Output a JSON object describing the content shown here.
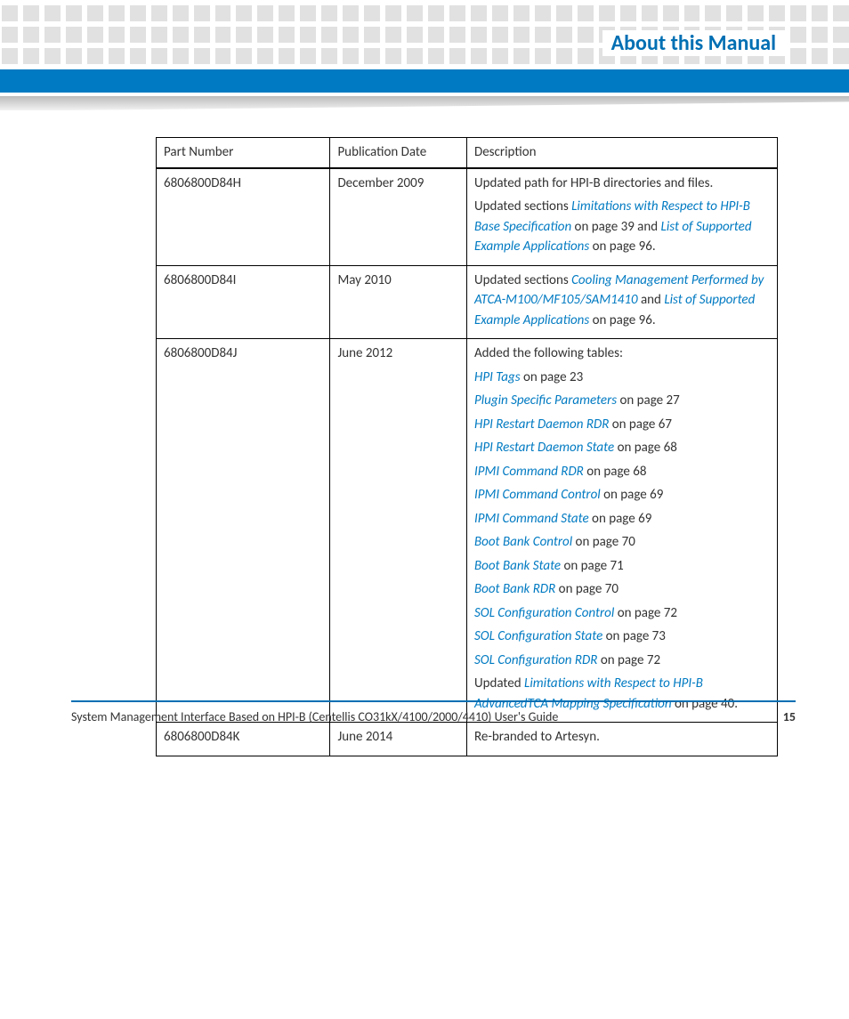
{
  "header": {
    "title": "About this Manual"
  },
  "table": {
    "columns": [
      "Part Number",
      "Publication Date",
      "Description"
    ],
    "rows": [
      {
        "part": "6806800D84H",
        "date": "December 2009",
        "desc": [
          [
            {
              "t": "Updated path for HPI-B directories and files."
            }
          ],
          [
            {
              "t": "Updated sections "
            },
            {
              "t": "Limitations with Respect to HPI-B Base Specification",
              "link": true
            },
            {
              "t": " on page 39 and "
            },
            {
              "t": "List of Supported Example Applications",
              "link": true
            },
            {
              "t": " on page 96."
            }
          ]
        ]
      },
      {
        "part": "6806800D84I",
        "date": "May 2010",
        "desc": [
          [
            {
              "t": "Updated sections "
            },
            {
              "t": "Cooling Management Performed by ATCA-M100/MF105/SAM1410",
              "link": true
            },
            {
              "t": " and "
            },
            {
              "t": "List of Supported Example Applications",
              "link": true
            },
            {
              "t": " on page 96."
            }
          ]
        ]
      },
      {
        "part": "6806800D84J",
        "date": "June 2012",
        "desc": [
          [
            {
              "t": "Added the following tables:"
            }
          ],
          [
            {
              "t": "HPI Tags",
              "link": true
            },
            {
              "t": " on page 23"
            }
          ],
          [
            {
              "t": "Plugin Specific Parameters",
              "link": true
            },
            {
              "t": " on page 27"
            }
          ],
          [
            {
              "t": "HPI Restart Daemon RDR",
              "link": true
            },
            {
              "t": " on page 67"
            }
          ],
          [
            {
              "t": "HPI Restart Daemon State",
              "link": true
            },
            {
              "t": " on page 68"
            }
          ],
          [
            {
              "t": "IPMI Command RDR",
              "link": true
            },
            {
              "t": " on page 68"
            }
          ],
          [
            {
              "t": "IPMI Command Control",
              "link": true
            },
            {
              "t": " on page 69"
            }
          ],
          [
            {
              "t": "IPMI Command State",
              "link": true
            },
            {
              "t": " on page 69"
            }
          ],
          [
            {
              "t": "Boot Bank Control",
              "link": true
            },
            {
              "t": " on page 70"
            }
          ],
          [
            {
              "t": "Boot Bank State",
              "link": true
            },
            {
              "t": " on page 71"
            }
          ],
          [
            {
              "t": "Boot Bank RDR",
              "link": true
            },
            {
              "t": " on page 70"
            }
          ],
          [
            {
              "t": "SOL Configuration Control",
              "link": true
            },
            {
              "t": " on page 72"
            }
          ],
          [
            {
              "t": "SOL Configuration State",
              "link": true
            },
            {
              "t": " on page 73"
            }
          ],
          [
            {
              "t": "SOL Configuration RDR",
              "link": true
            },
            {
              "t": " on page 72"
            }
          ],
          [
            {
              "t": "Updated "
            },
            {
              "t": "Limitations with Respect to HPI-B AdvancedTCA Mapping Specification",
              "link": true
            },
            {
              "t": " on page 40."
            }
          ]
        ]
      },
      {
        "part": "6806800D84K",
        "date": "June 2014",
        "desc": [
          [
            {
              "t": "Re-branded to Artesyn."
            }
          ]
        ]
      }
    ]
  },
  "footer": {
    "text": "System Management Interface Based on HPI-B (Centellis CO31kX/4100/2000/4410) User's Guide",
    "page": "15"
  }
}
